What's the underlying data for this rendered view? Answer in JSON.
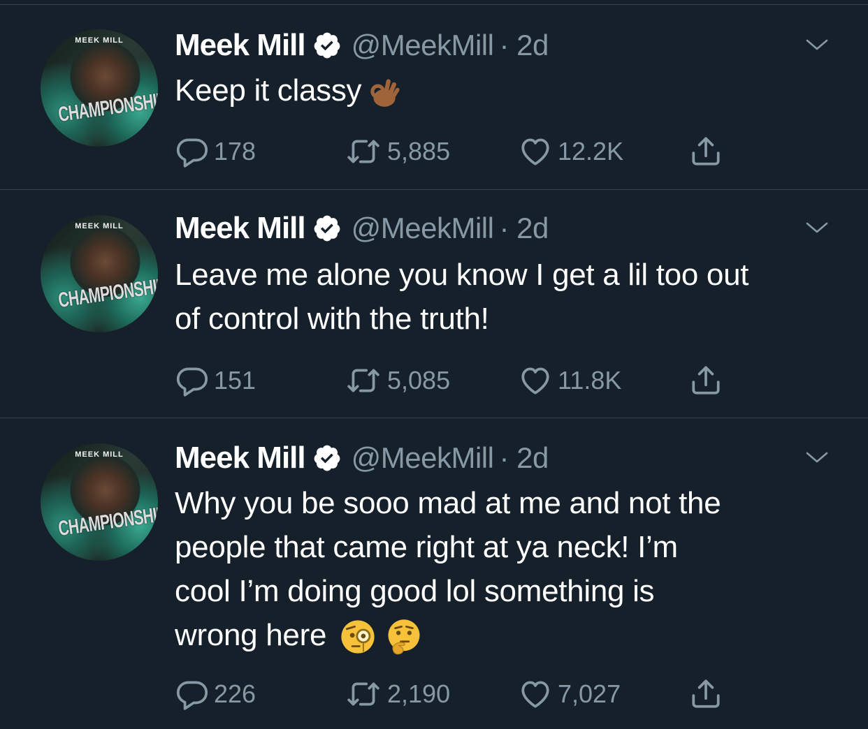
{
  "colors": {
    "background": "#15202b",
    "separator": "#38444d",
    "secondary_text": "#8899a6",
    "primary_text": "#ffffff",
    "verified_badge": "#ffffff"
  },
  "avatar": {
    "top_text": "MEEK MILL",
    "main_text": "CHAMPIONSHIPS"
  },
  "tweets": [
    {
      "name": "Meek Mill",
      "handle": "@MeekMill",
      "time": "· 2d",
      "text": "Keep it classy",
      "emojis": [
        "ok-hand-icon"
      ],
      "replies": "178",
      "retweets": "5,885",
      "likes": "12.2K"
    },
    {
      "name": "Meek Mill",
      "handle": "@MeekMill",
      "time": "· 2d",
      "text_lines": [
        "Leave me alone you know I get a lil too out",
        "of control with the truth!"
      ],
      "replies": "151",
      "retweets": "5,085",
      "likes": "11.8K"
    },
    {
      "name": "Meek Mill",
      "handle": "@MeekMill",
      "time": "· 2d",
      "text_lines": [
        "Why you be sooo mad at me and not the",
        "people that came right at ya neck!  I’m",
        "cool I’m doing good  lol something is",
        "wrong here"
      ],
      "emojis": [
        "monocle-face-icon",
        "thinking-face-icon"
      ],
      "replies": "226",
      "retweets": "2,190",
      "likes": "7,027"
    }
  ]
}
